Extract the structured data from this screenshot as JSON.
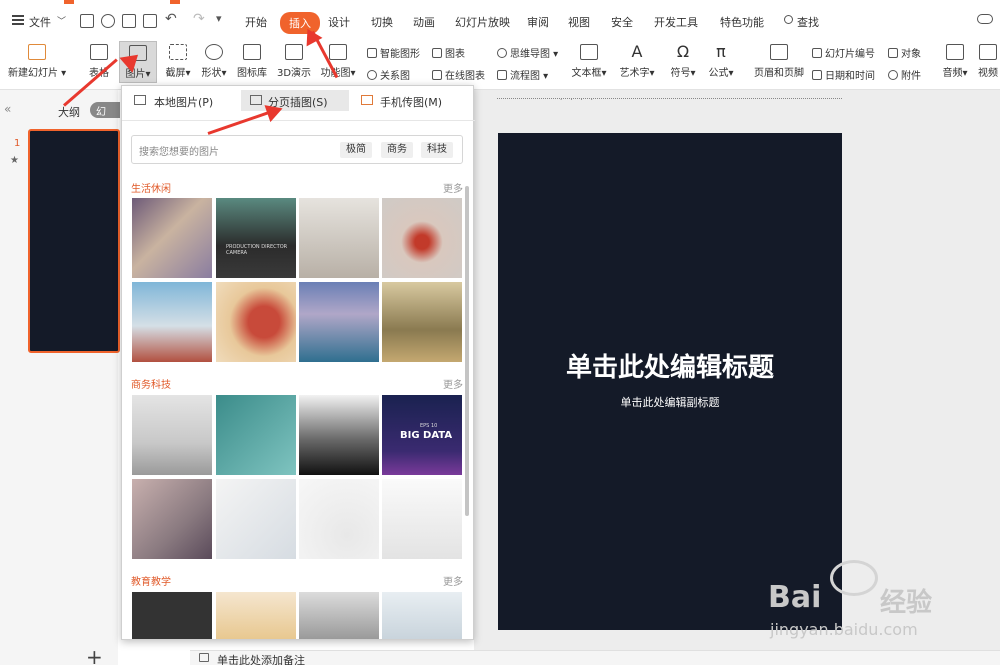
{
  "menubar": {
    "file": "文件",
    "tabs": [
      "开始",
      "插入",
      "设计",
      "切换",
      "动画",
      "幻灯片放映",
      "审阅",
      "视图",
      "安全",
      "开发工具",
      "特色功能"
    ],
    "active_tab": "插入",
    "search": "查找"
  },
  "ribbon": {
    "new_slide": "新建幻灯片",
    "table": "表格",
    "picture": "图片",
    "screenshot": "截屏",
    "shape": "形状",
    "icon_lib": "图标库",
    "demo3d": "3D演示",
    "function_chart": "功能图",
    "smart_shape": "智能图形",
    "chart": "图表",
    "mindmap": "思维导图",
    "relation": "关系图",
    "online_chart": "在线图表",
    "flowchart": "流程图",
    "textbox": "文本框",
    "wordart": "艺术字",
    "symbol": "符号",
    "formula": "公式",
    "header_footer": "页眉和页脚",
    "slide_number": "幻灯片编号",
    "object": "对象",
    "datetime": "日期和时间",
    "attachment": "附件",
    "audio": "音频",
    "video": "视频"
  },
  "leftpane": {
    "outline": "大纲",
    "slides": "幻灯",
    "slide_num": "1",
    "star": "★",
    "add": "+"
  },
  "dropdown": {
    "tab_local": "本地图片(P)",
    "tab_pages": "分页插图(S)",
    "tab_phone": "手机传图(M)",
    "search_placeholder": "搜索您想要的图片",
    "tags": [
      "极简",
      "商务",
      "科技"
    ],
    "categories": [
      {
        "title": "生活休闲",
        "more": "更多"
      },
      {
        "title": "商务科技",
        "more": "更多"
      },
      {
        "title": "教育教学",
        "more": "更多"
      }
    ],
    "big_data_line1": "EPS 10",
    "big_data_line2": "BIG DATA",
    "photo_caption": "PRODUCTION DIRECTOR CAMERA"
  },
  "slide": {
    "title": "单击此处编辑标题",
    "subtitle": "单击此处编辑副标题"
  },
  "notes": {
    "text": "单击此处添加备注"
  },
  "watermark": {
    "brand": "Bai",
    "brand_cn": "经验",
    "url": "jingyan.baidu.com"
  },
  "colors": {
    "accent": "#f0632c",
    "slide_bg": "#141a28",
    "arrow": "#e8382e"
  }
}
